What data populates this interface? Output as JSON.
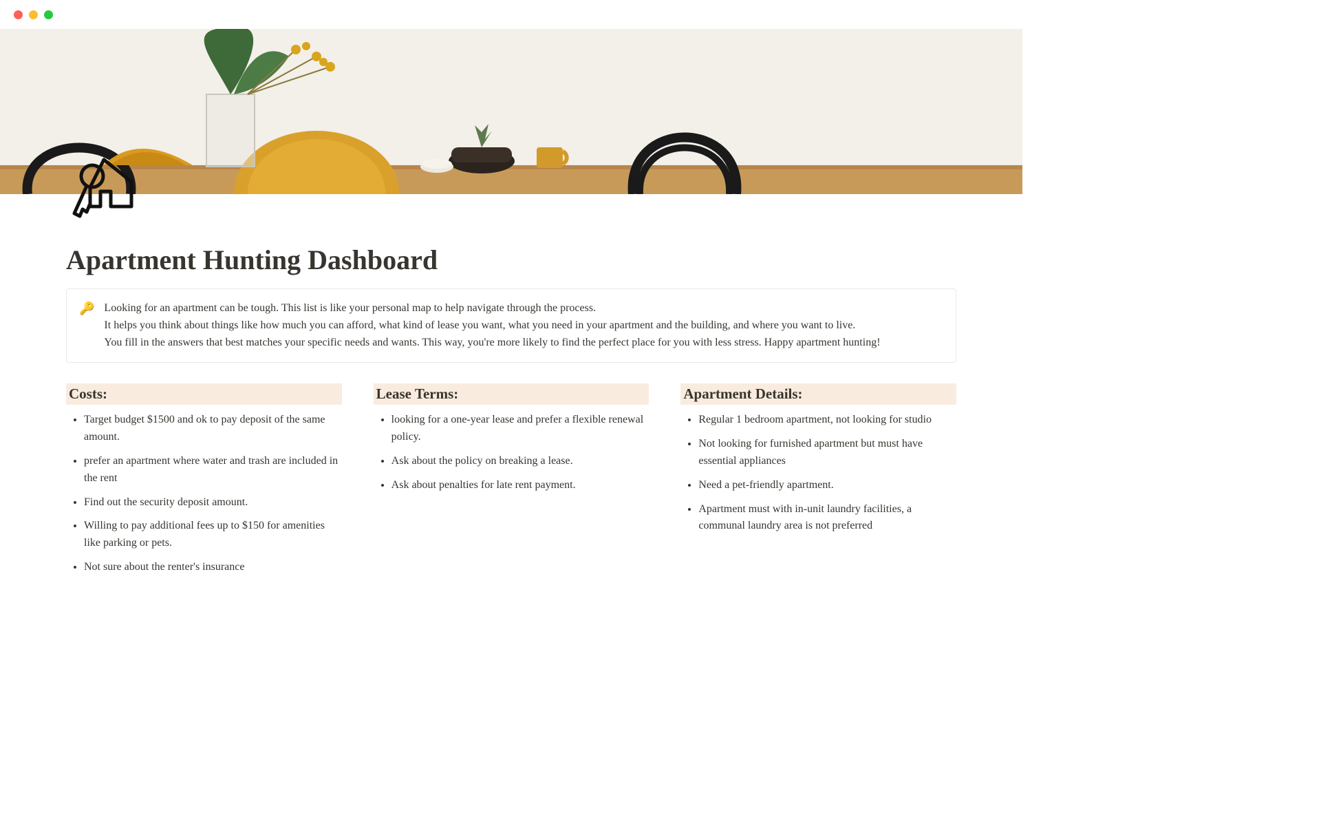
{
  "title": "Apartment Hunting Dashboard",
  "callout": {
    "emoji": "🔑",
    "p1": "Looking for an apartment can be tough. This list is like your personal map to help navigate through the process.",
    "p2": "It helps you think about things like how much you can afford, what kind of lease you want, what you need in your apartment and the building, and where you want to live.",
    "p3": "You fill in the answers that best matches your specific needs and wants. This way, you're more likely to find the perfect place for you with less stress. Happy apartment hunting!"
  },
  "columns": {
    "costs": {
      "heading": "Costs:",
      "items": [
        "Target budget $1500 and ok to pay deposit of the same amount.",
        "prefer an apartment where water and trash are included in the rent",
        "Find out the security deposit amount.",
        "Willing to pay additional fees up to $150 for amenities like parking or pets.",
        "Not sure about the renter's insurance"
      ]
    },
    "lease": {
      "heading": "Lease Terms:",
      "items": [
        "looking for a one-year lease and prefer a flexible renewal policy.",
        "Ask about the policy on breaking a lease.",
        "Ask about penalties for late rent payment."
      ]
    },
    "details": {
      "heading": "Apartment Details:",
      "items": [
        "Regular 1 bedroom apartment, not looking for studio",
        "Not looking for furnished apartment but must have essential appliances",
        "Need a pet-friendly apartment.",
        "Apartment must  with in-unit laundry facilities, a communal laundry area is not preferred"
      ]
    }
  }
}
